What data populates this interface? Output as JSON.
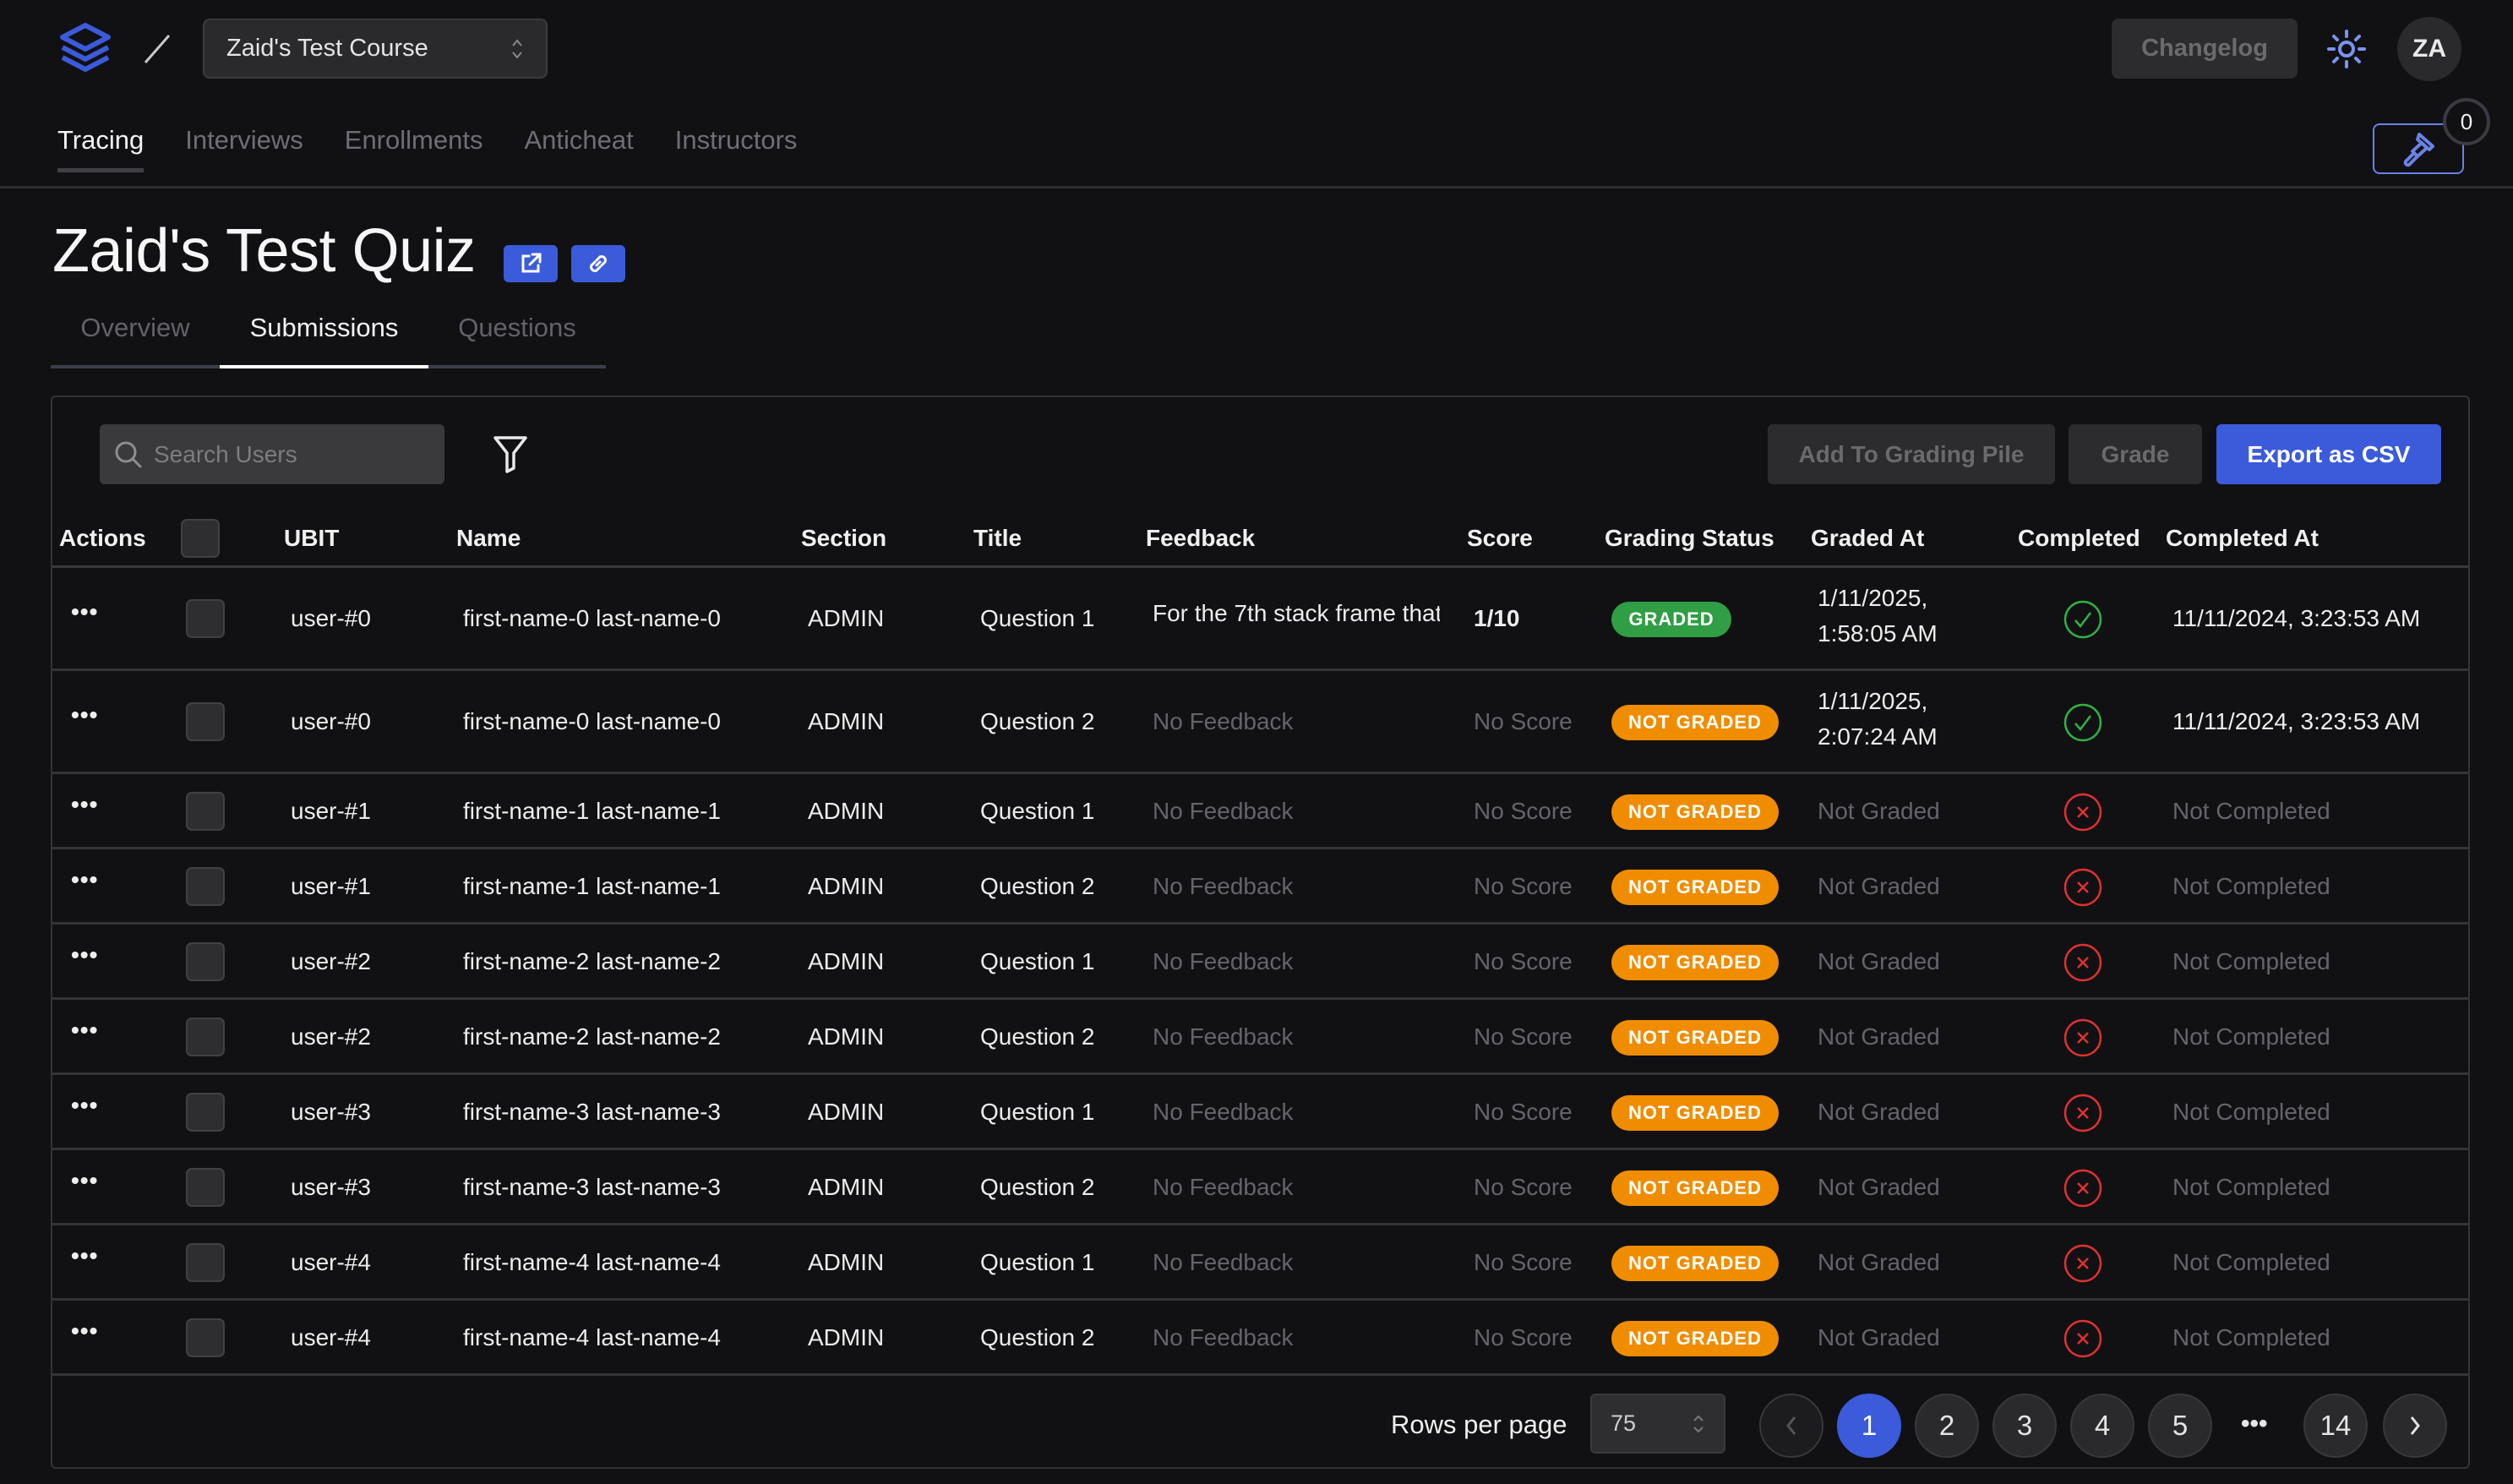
{
  "topbar": {
    "course_selector": "Zaid's Test Course",
    "changelog_label": "Changelog",
    "avatar_initials": "ZA",
    "grading_pile_count": "0"
  },
  "nav": {
    "items": [
      {
        "label": "Tracing",
        "active": true
      },
      {
        "label": "Interviews",
        "active": false
      },
      {
        "label": "Enrollments",
        "active": false
      },
      {
        "label": "Anticheat",
        "active": false
      },
      {
        "label": "Instructors",
        "active": false
      }
    ]
  },
  "page": {
    "title": "Zaid's Test Quiz",
    "subtabs": [
      {
        "label": "Overview",
        "active": false
      },
      {
        "label": "Submissions",
        "active": true
      },
      {
        "label": "Questions",
        "active": false
      }
    ]
  },
  "toolbar": {
    "search_placeholder": "Search Users",
    "search_value": "",
    "add_to_grading_pile": "Add To Grading Pile",
    "grade": "Grade",
    "export_csv": "Export as CSV"
  },
  "table": {
    "headers": {
      "actions": "Actions",
      "ubit": "UBIT",
      "name": "Name",
      "section": "Section",
      "title": "Title",
      "feedback": "Feedback",
      "score": "Score",
      "grading_status": "Grading Status",
      "graded_at": "Graded At",
      "completed": "Completed",
      "completed_at": "Completed At"
    },
    "rows": [
      {
        "ubit": "user-#0",
        "name": "first-name-0 last-name-0",
        "section": "ADMIN",
        "title": "Question 1",
        "feedback": "For the 7th stack frame that",
        "score": "1/10",
        "status": "GRADED",
        "graded_at_date": "1/11/2025,",
        "graded_at_time": "1:58:05 AM",
        "completed": true,
        "completed_at": "11/11/2024, 3:23:53 AM"
      },
      {
        "ubit": "user-#0",
        "name": "first-name-0 last-name-0",
        "section": "ADMIN",
        "title": "Question 2",
        "feedback": "No Feedback",
        "score": "No Score",
        "status": "NOT GRADED",
        "graded_at_date": "1/11/2025,",
        "graded_at_time": "2:07:24 AM",
        "completed": true,
        "completed_at": "11/11/2024, 3:23:53 AM"
      },
      {
        "ubit": "user-#1",
        "name": "first-name-1 last-name-1",
        "section": "ADMIN",
        "title": "Question 1",
        "feedback": "No Feedback",
        "score": "No Score",
        "status": "NOT GRADED",
        "graded_at": "Not Graded",
        "completed": false,
        "completed_at": "Not Completed"
      },
      {
        "ubit": "user-#1",
        "name": "first-name-1 last-name-1",
        "section": "ADMIN",
        "title": "Question 2",
        "feedback": "No Feedback",
        "score": "No Score",
        "status": "NOT GRADED",
        "graded_at": "Not Graded",
        "completed": false,
        "completed_at": "Not Completed"
      },
      {
        "ubit": "user-#2",
        "name": "first-name-2 last-name-2",
        "section": "ADMIN",
        "title": "Question 1",
        "feedback": "No Feedback",
        "score": "No Score",
        "status": "NOT GRADED",
        "graded_at": "Not Graded",
        "completed": false,
        "completed_at": "Not Completed"
      },
      {
        "ubit": "user-#2",
        "name": "first-name-2 last-name-2",
        "section": "ADMIN",
        "title": "Question 2",
        "feedback": "No Feedback",
        "score": "No Score",
        "status": "NOT GRADED",
        "graded_at": "Not Graded",
        "completed": false,
        "completed_at": "Not Completed"
      },
      {
        "ubit": "user-#3",
        "name": "first-name-3 last-name-3",
        "section": "ADMIN",
        "title": "Question 1",
        "feedback": "No Feedback",
        "score": "No Score",
        "status": "NOT GRADED",
        "graded_at": "Not Graded",
        "completed": false,
        "completed_at": "Not Completed"
      },
      {
        "ubit": "user-#3",
        "name": "first-name-3 last-name-3",
        "section": "ADMIN",
        "title": "Question 2",
        "feedback": "No Feedback",
        "score": "No Score",
        "status": "NOT GRADED",
        "graded_at": "Not Graded",
        "completed": false,
        "completed_at": "Not Completed"
      },
      {
        "ubit": "user-#4",
        "name": "first-name-4 last-name-4",
        "section": "ADMIN",
        "title": "Question 1",
        "feedback": "No Feedback",
        "score": "No Score",
        "status": "NOT GRADED",
        "graded_at": "Not Graded",
        "completed": false,
        "completed_at": "Not Completed"
      },
      {
        "ubit": "user-#4",
        "name": "first-name-4 last-name-4",
        "section": "ADMIN",
        "title": "Question 2",
        "feedback": "No Feedback",
        "score": "No Score",
        "status": "NOT GRADED",
        "graded_at": "Not Graded",
        "completed": false,
        "completed_at": "Not Completed"
      }
    ]
  },
  "pagination": {
    "rows_per_page_label": "Rows per page",
    "rows_per_page": "75",
    "pages": [
      "1",
      "2",
      "3",
      "4",
      "5"
    ],
    "ellipsis": "•••",
    "last_page": "14",
    "current_page": "1"
  },
  "colors": {
    "accent": "#3b5bdb",
    "graded": "#2f9e44",
    "not_graded": "#f08c00",
    "completed": "#2fb344",
    "not_completed": "#e03131"
  }
}
